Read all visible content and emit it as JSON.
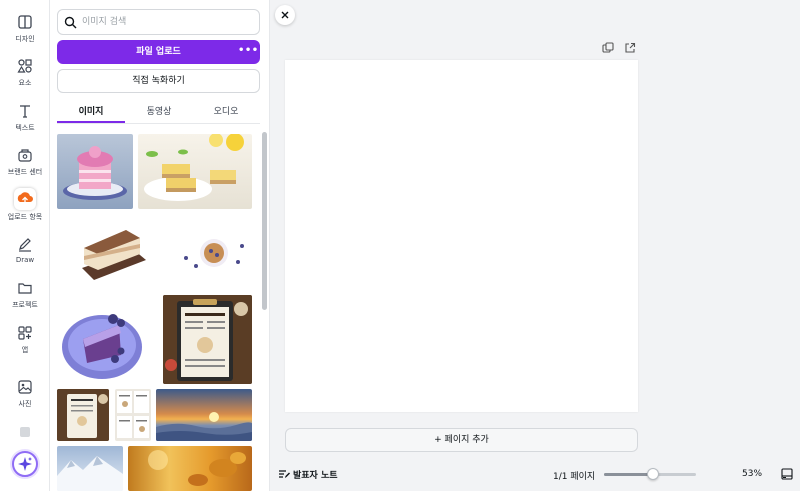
{
  "rail": {
    "items": [
      {
        "label": "디자인",
        "icon": "design-icon"
      },
      {
        "label": "요소",
        "icon": "elements-icon"
      },
      {
        "label": "텍스트",
        "icon": "text-icon"
      },
      {
        "label": "브랜드 센터",
        "icon": "brand-icon"
      },
      {
        "label": "업로드 항목",
        "icon": "upload-icon"
      },
      {
        "label": "Draw",
        "icon": "draw-icon"
      },
      {
        "label": "프로젝트",
        "icon": "folder-icon"
      },
      {
        "label": "앱",
        "icon": "apps-icon"
      },
      {
        "label": "사진",
        "icon": "photo-icon"
      }
    ],
    "magic_icon": "sparkle-icon"
  },
  "panel": {
    "search_placeholder": "이미지 검색",
    "upload_button": "파일 업로드",
    "more_label": "•••",
    "record_button": "직접 녹화하기",
    "tabs": [
      {
        "label": "이미지",
        "active": true
      },
      {
        "label": "동영상",
        "active": false
      },
      {
        "label": "오디오",
        "active": false
      }
    ],
    "images": [
      "pink-layer-cake-slice",
      "lemon-bars-plate",
      "tiramisu-slice-board",
      "blueberry-muffin-topview",
      "purple-cake-slice-plate",
      "restaurant-menu-clipboard",
      "menu-board-small",
      "menu-sheets-collage",
      "sunrise-over-clouds",
      "snowy-mountain",
      "autumn-leaves-bokeh"
    ]
  },
  "editor": {
    "add_page": "+ 페이지 추가"
  },
  "footer": {
    "notes_label": "발표자 노트",
    "page_count": "1/1 페이지",
    "zoom_value": 0.53,
    "zoom_label": "53%"
  },
  "colors": {
    "accent": "#7d2ae8",
    "upload_orange": "#f26b1d"
  }
}
